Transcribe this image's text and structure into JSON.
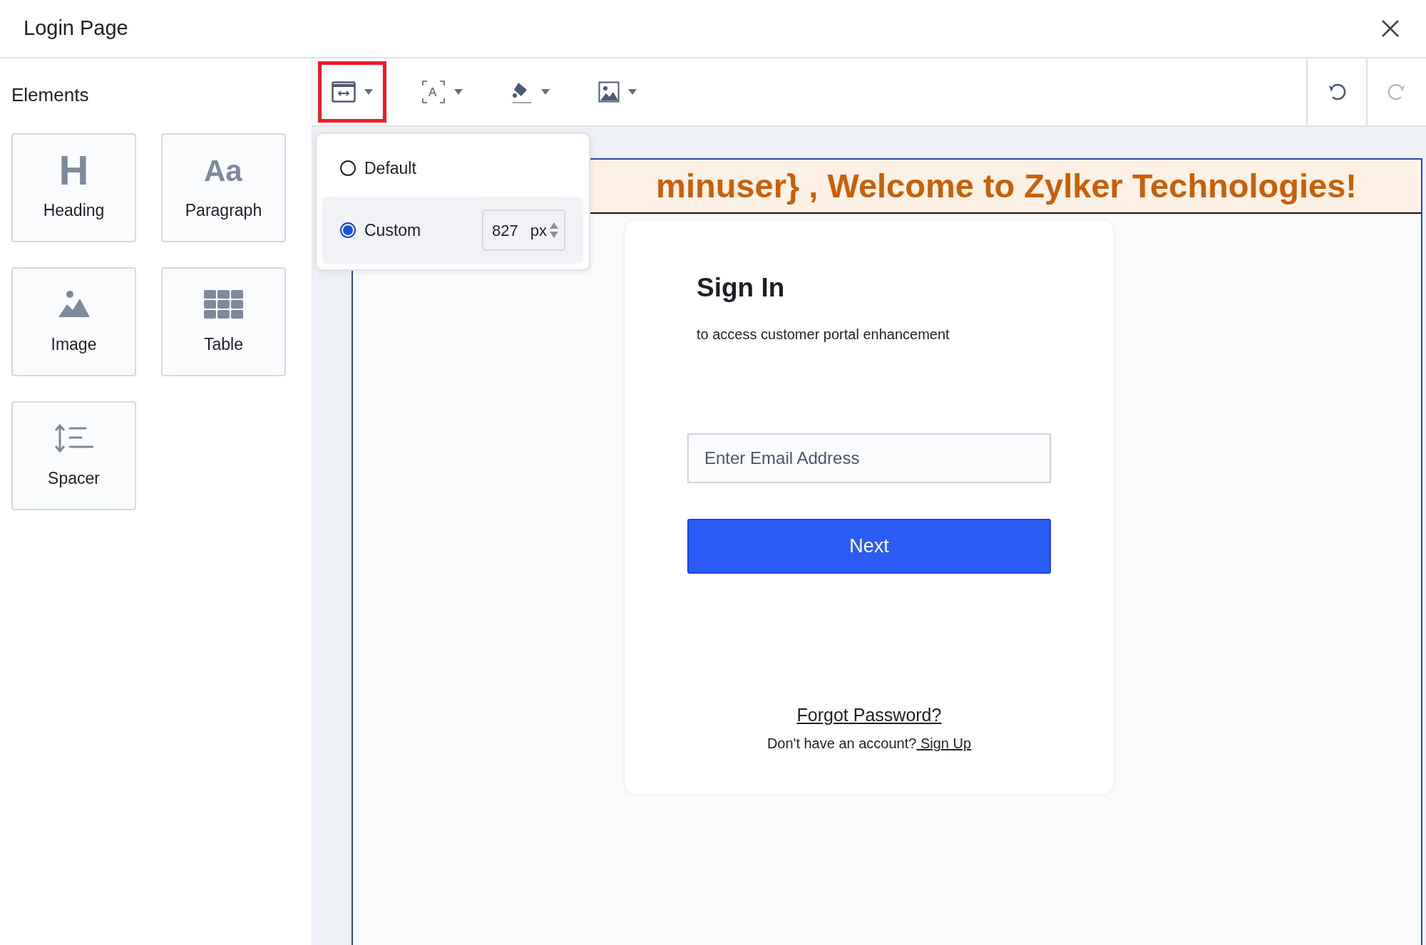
{
  "window": {
    "title": "Login Page"
  },
  "elements_panel": {
    "title": "Elements",
    "items": [
      {
        "label": "Heading",
        "kind": "heading",
        "glyph": "H"
      },
      {
        "label": "Paragraph",
        "kind": "paragraph",
        "glyph": "Aa"
      },
      {
        "label": "Image",
        "kind": "image"
      },
      {
        "label": "Table",
        "kind": "table"
      },
      {
        "label": "Spacer",
        "kind": "spacer"
      }
    ]
  },
  "toolbar": {
    "tools": [
      {
        "kind": "width",
        "selected": true
      },
      {
        "kind": "text",
        "selected": false,
        "glyph": "A"
      },
      {
        "kind": "fill",
        "selected": false
      },
      {
        "kind": "image",
        "selected": false
      }
    ],
    "history": [
      {
        "kind": "undo",
        "disabled": false
      },
      {
        "kind": "redo",
        "disabled": true
      }
    ]
  },
  "width_popover": {
    "options": [
      {
        "label": "Default",
        "selected": false
      },
      {
        "label": "Custom",
        "selected": true
      }
    ],
    "custom_value": "827",
    "unit": "px"
  },
  "canvas": {
    "banner": "minuser} , Welcome to Zylker Technologies!",
    "card": {
      "title": "Sign In",
      "subtitle": "to access customer portal enhancement",
      "email_placeholder": "Enter Email Address",
      "next_button": "Next",
      "forgot_link": "Forgot Password?",
      "signup_prompt": "Don't have an account?",
      "signup_link": " Sign Up"
    }
  }
}
